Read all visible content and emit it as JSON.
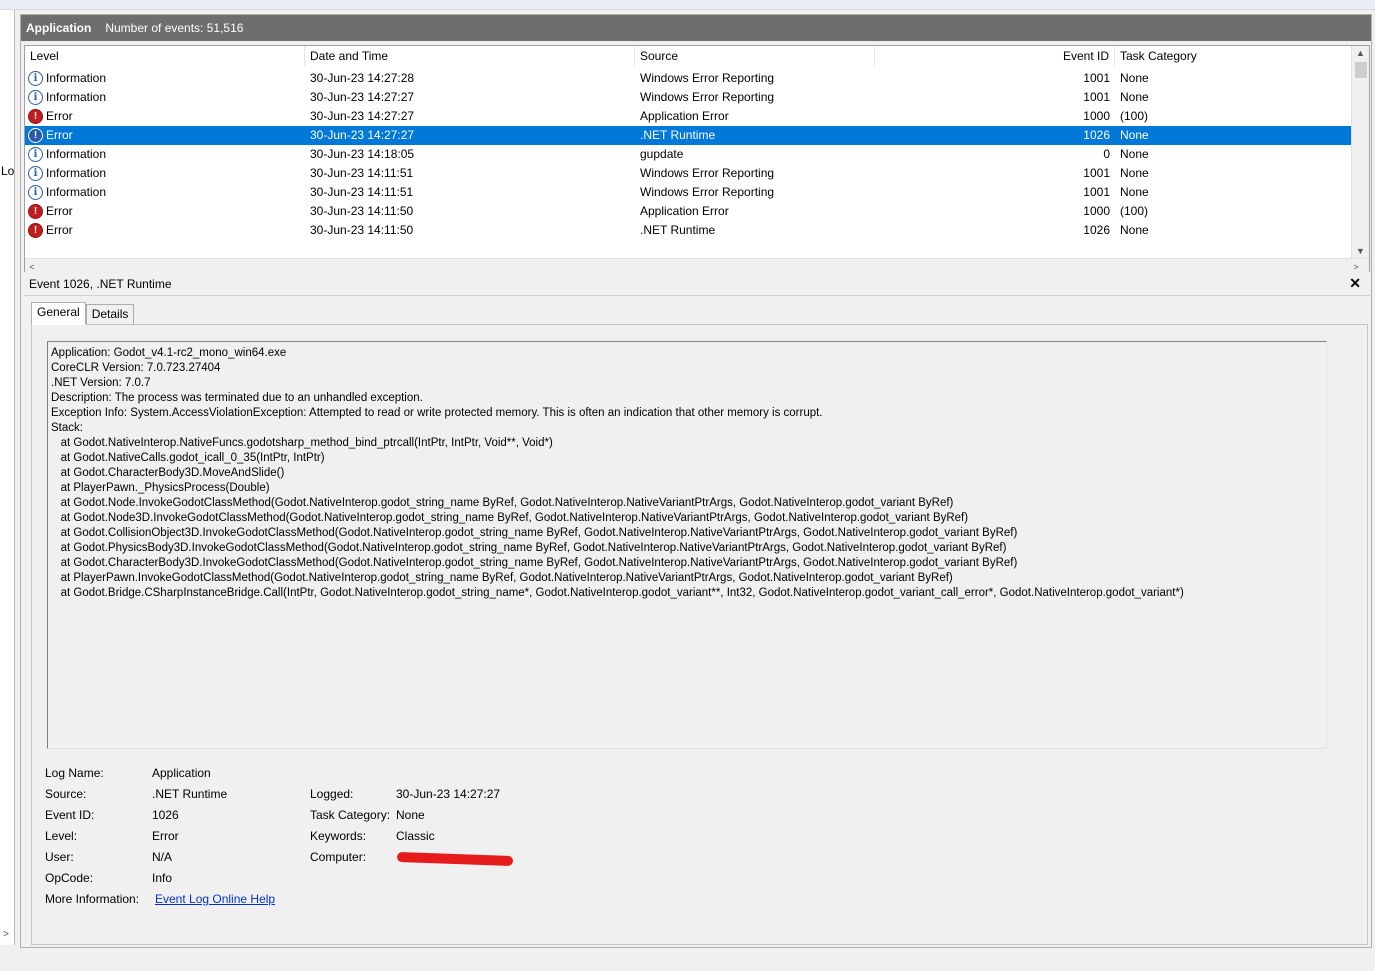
{
  "left_truncated_label": "Lo",
  "header": {
    "log_name": "Application",
    "event_count": "Number of events: 51,516"
  },
  "grid": {
    "columns": [
      "Level",
      "Date and Time",
      "Source",
      "Event ID",
      "Task Category"
    ],
    "rows": [
      {
        "level": "Information",
        "icon": "info-icon",
        "date": "30-Jun-23 14:27:28",
        "source": "Windows Error Reporting",
        "event_id": "1001",
        "category": "None",
        "selected": false
      },
      {
        "level": "Information",
        "icon": "info-icon",
        "date": "30-Jun-23 14:27:27",
        "source": "Windows Error Reporting",
        "event_id": "1001",
        "category": "None",
        "selected": false
      },
      {
        "level": "Error",
        "icon": "error-icon",
        "date": "30-Jun-23 14:27:27",
        "source": "Application Error",
        "event_id": "1000",
        "category": "(100)",
        "selected": false
      },
      {
        "level": "Error",
        "icon": "error-icon",
        "date": "30-Jun-23 14:27:27",
        "source": ".NET Runtime",
        "event_id": "1026",
        "category": "None",
        "selected": true
      },
      {
        "level": "Information",
        "icon": "info-icon",
        "date": "30-Jun-23 14:18:05",
        "source": "gupdate",
        "event_id": "0",
        "category": "None",
        "selected": false
      },
      {
        "level": "Information",
        "icon": "info-icon",
        "date": "30-Jun-23 14:11:51",
        "source": "Windows Error Reporting",
        "event_id": "1001",
        "category": "None",
        "selected": false
      },
      {
        "level": "Information",
        "icon": "info-icon",
        "date": "30-Jun-23 14:11:51",
        "source": "Windows Error Reporting",
        "event_id": "1001",
        "category": "None",
        "selected": false
      },
      {
        "level": "Error",
        "icon": "error-icon",
        "date": "30-Jun-23 14:11:50",
        "source": "Application Error",
        "event_id": "1000",
        "category": "(100)",
        "selected": false
      },
      {
        "level": "Error",
        "icon": "error-icon",
        "date": "30-Jun-23 14:11:50",
        "source": ".NET Runtime",
        "event_id": "1026",
        "category": "None",
        "selected": false
      }
    ]
  },
  "detail": {
    "title": "Event 1026, .NET Runtime",
    "close_label": "✕",
    "tabs": [
      "General",
      "Details"
    ],
    "active_tab": "General",
    "description_lines": [
      "Application: Godot_v4.1-rc2_mono_win64.exe",
      "CoreCLR Version: 7.0.723.27404",
      ".NET Version: 7.0.7",
      "Description: The process was terminated due to an unhandled exception.",
      "Exception Info: System.AccessViolationException: Attempted to read or write protected memory. This is often an indication that other memory is corrupt.",
      "Stack:",
      "   at Godot.NativeInterop.NativeFuncs.godotsharp_method_bind_ptrcall(IntPtr, IntPtr, Void**, Void*)",
      "   at Godot.NativeCalls.godot_icall_0_35(IntPtr, IntPtr)",
      "   at Godot.CharacterBody3D.MoveAndSlide()",
      "   at PlayerPawn._PhysicsProcess(Double)",
      "   at Godot.Node.InvokeGodotClassMethod(Godot.NativeInterop.godot_string_name ByRef, Godot.NativeInterop.NativeVariantPtrArgs, Godot.NativeInterop.godot_variant ByRef)",
      "   at Godot.Node3D.InvokeGodotClassMethod(Godot.NativeInterop.godot_string_name ByRef, Godot.NativeInterop.NativeVariantPtrArgs, Godot.NativeInterop.godot_variant ByRef)",
      "   at Godot.CollisionObject3D.InvokeGodotClassMethod(Godot.NativeInterop.godot_string_name ByRef, Godot.NativeInterop.NativeVariantPtrArgs, Godot.NativeInterop.godot_variant ByRef)",
      "   at Godot.PhysicsBody3D.InvokeGodotClassMethod(Godot.NativeInterop.godot_string_name ByRef, Godot.NativeInterop.NativeVariantPtrArgs, Godot.NativeInterop.godot_variant ByRef)",
      "   at Godot.CharacterBody3D.InvokeGodotClassMethod(Godot.NativeInterop.godot_string_name ByRef, Godot.NativeInterop.NativeVariantPtrArgs, Godot.NativeInterop.godot_variant ByRef)",
      "   at PlayerPawn.InvokeGodotClassMethod(Godot.NativeInterop.godot_string_name ByRef, Godot.NativeInterop.NativeVariantPtrArgs, Godot.NativeInterop.godot_variant ByRef)",
      "   at Godot.Bridge.CSharpInstanceBridge.Call(IntPtr, Godot.NativeInterop.godot_string_name*, Godot.NativeInterop.godot_variant**, Int32, Godot.NativeInterop.godot_variant_call_error*, Godot.NativeInterop.godot_variant*)"
    ],
    "properties": {
      "log_name_label": "Log Name:",
      "log_name": "Application",
      "source_label": "Source:",
      "source": ".NET Runtime",
      "logged_label": "Logged:",
      "logged": "30-Jun-23 14:27:27",
      "event_id_label": "Event ID:",
      "event_id": "1026",
      "task_category_label": "Task Category:",
      "task_category": "None",
      "level_label": "Level:",
      "level": "Error",
      "keywords_label": "Keywords:",
      "keywords": "Classic",
      "user_label": "User:",
      "user": "N/A",
      "computer_label": "Computer:",
      "opcode_label": "OpCode:",
      "opcode": "Info",
      "more_info_label": "More Information:",
      "more_info_link": "Event Log Online Help"
    }
  },
  "colors": {
    "selection": "#0078d7",
    "title_bar": "#6e6e6e",
    "error_red": "#c21d1d",
    "info_blue": "#2a5aa8",
    "redaction": "#e61c1c",
    "link": "#0033cc"
  }
}
